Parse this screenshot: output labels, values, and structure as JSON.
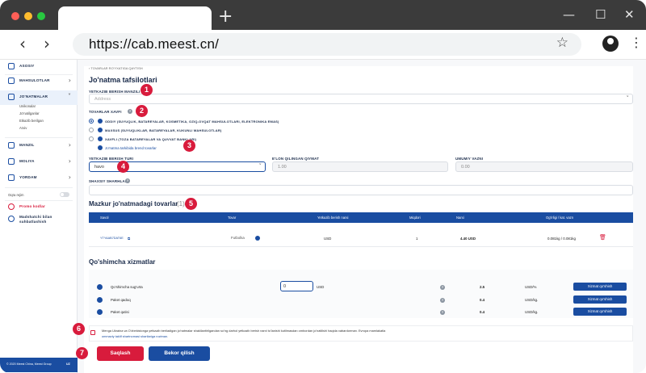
{
  "browser": {
    "url": "https://cab.meest.cn/",
    "new_tab": "+",
    "back": "‹",
    "forward": "›",
    "star": "☆",
    "menu": "⋮",
    "win_min": "—",
    "win_max": "☐",
    "win_close": "✕"
  },
  "colors": {
    "primary": "#1a4da1",
    "accent": "#d81b3c",
    "titlebar": "#3b3b3b"
  },
  "sidebar": {
    "items": [
      {
        "label": "ASOSIY"
      },
      {
        "label": "MAHSULOTLAR"
      },
      {
        "label": "JO'NATMALAR"
      },
      {
        "label": "MANZIL"
      },
      {
        "label": "MOLIYA"
      },
      {
        "label": "YORDAM"
      }
    ],
    "sub_items": [
      "Unikonalar",
      "Jo'natilganlar",
      "Etkazib berilgan",
      "Arxiv"
    ],
    "dark_mode": "Oqrа rejim",
    "promo": "Promo kodlar",
    "manager": "Madshatchi bilan suhbatlashish",
    "footer_left": "© 2020 Meest China, Meest Group",
    "footer_lang": "UZ"
  },
  "page": {
    "back_link": "‹  TOVARLAR RO'YXATIGA QAYTISH",
    "title": "Jo'natma tafsilotlari",
    "supplier_label": "YETKAZIB BERISH MANZILI *",
    "address_placeholder": "Address",
    "goods_risk_label": "TOVARLAR XAVFI",
    "risk_options": [
      "ODDIY (SUYUQLIK, BATAREYALAR, KOSMETIKA, OZIQ-OVQAT MAHSULOTLARI, ELEKTRONIKA EMAS)",
      "MAXSUS (SUYUQLIKLAR, BATAREYALAR, KUKUNLI MAHSULOTLAR)",
      "XAVFLI (TOZA BATAREYALAR VA QUVVAT BANKLARI)"
    ],
    "brand_option": "Jo'natma tarkibida brend tovarlar",
    "delivery_type_label": "YETKAZIB BERISH TURI",
    "delivery_type_value": "havo",
    "declared_value_label": "E'LON QILINGAN QIYMAT",
    "declared_value": "1.00",
    "total_weight_label": "UMUMIY VAZNI",
    "total_weight": "0.00",
    "comments_label": "SHAXSIY SHARHLAR"
  },
  "goods": {
    "heading": "Mazkur jo'natmadagi tovarlar",
    "count": "(1)",
    "columns": [
      "Savol",
      "Tovar",
      "Yetkazib berish narxi",
      "Miqdori",
      "Narxi",
      "Og'irligi / kat. vazn"
    ],
    "row": {
      "code": "YTYAAB7DAT6E",
      "product": "Futbolka",
      "currency": "USD",
      "qty": "1",
      "price": "4.40 USD",
      "weight": "0.081kg / 0.081kg"
    }
  },
  "services": {
    "heading": "Qo'shimcha xizmatlar",
    "items": [
      {
        "name": "Qo'shimcha sug'urta",
        "input": "0",
        "unit_label": "USD",
        "price": "2.5",
        "unit": "USD/%",
        "button": "Xizmat qo'shish"
      },
      {
        "name": "Paket qadoq",
        "price": "0.4",
        "unit": "USD/kg.",
        "button": "Xizmat qo'shish"
      },
      {
        "name": "Paket qutisi",
        "price": "0.4",
        "unit": "USD/kg.",
        "button": "Xizmat qo'shish"
      }
    ]
  },
  "consent": {
    "text": "Menga Ukraina va O'zbekistonga yetkazib beriladigan jo'natmalar shakllantirilgandan so'ng darhol yetkazib berish narxi to'lanishi kutilmasdan ombordan jo'natilishi haqida xabardorman. Evropa mamlakatla",
    "link": "ommaviy taklif shartnomasi shartlariga roziman."
  },
  "actions": {
    "save": "Saqlash",
    "cancel": "Bekor qilish"
  },
  "badges": [
    "1",
    "2",
    "3",
    "4",
    "5",
    "6",
    "7"
  ]
}
